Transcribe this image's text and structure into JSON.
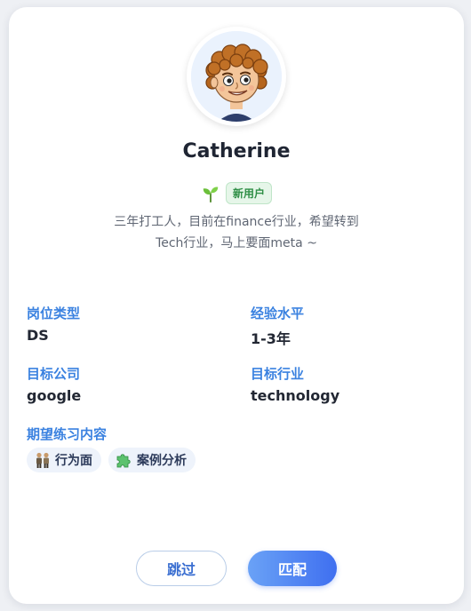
{
  "profile": {
    "name": "Catherine",
    "badge": "新用户",
    "bio_line1": "三年打工人，目前在finance行业，希望转到",
    "bio_line2": "Tech行业，马上要面meta ~"
  },
  "fields": {
    "role_label": "岗位类型",
    "role_value": "DS",
    "experience_label": "经验水平",
    "experience_value": "1-3年",
    "company_label": "目标公司",
    "company_value": "google",
    "industry_label": "目标行业",
    "industry_value": "technology",
    "practice_label": "期望练习内容"
  },
  "practice_items": [
    {
      "label": "行为面",
      "icon": "people-icon"
    },
    {
      "label": "案例分析",
      "icon": "puzzle-icon"
    }
  ],
  "actions": {
    "skip_label": "跳过",
    "match_label": "匹配"
  },
  "colors": {
    "accent": "#3b82e0",
    "badge_green": "#2f8f46",
    "match_gradient_start": "#6aa2f6",
    "match_gradient_end": "#3f6ff0"
  }
}
